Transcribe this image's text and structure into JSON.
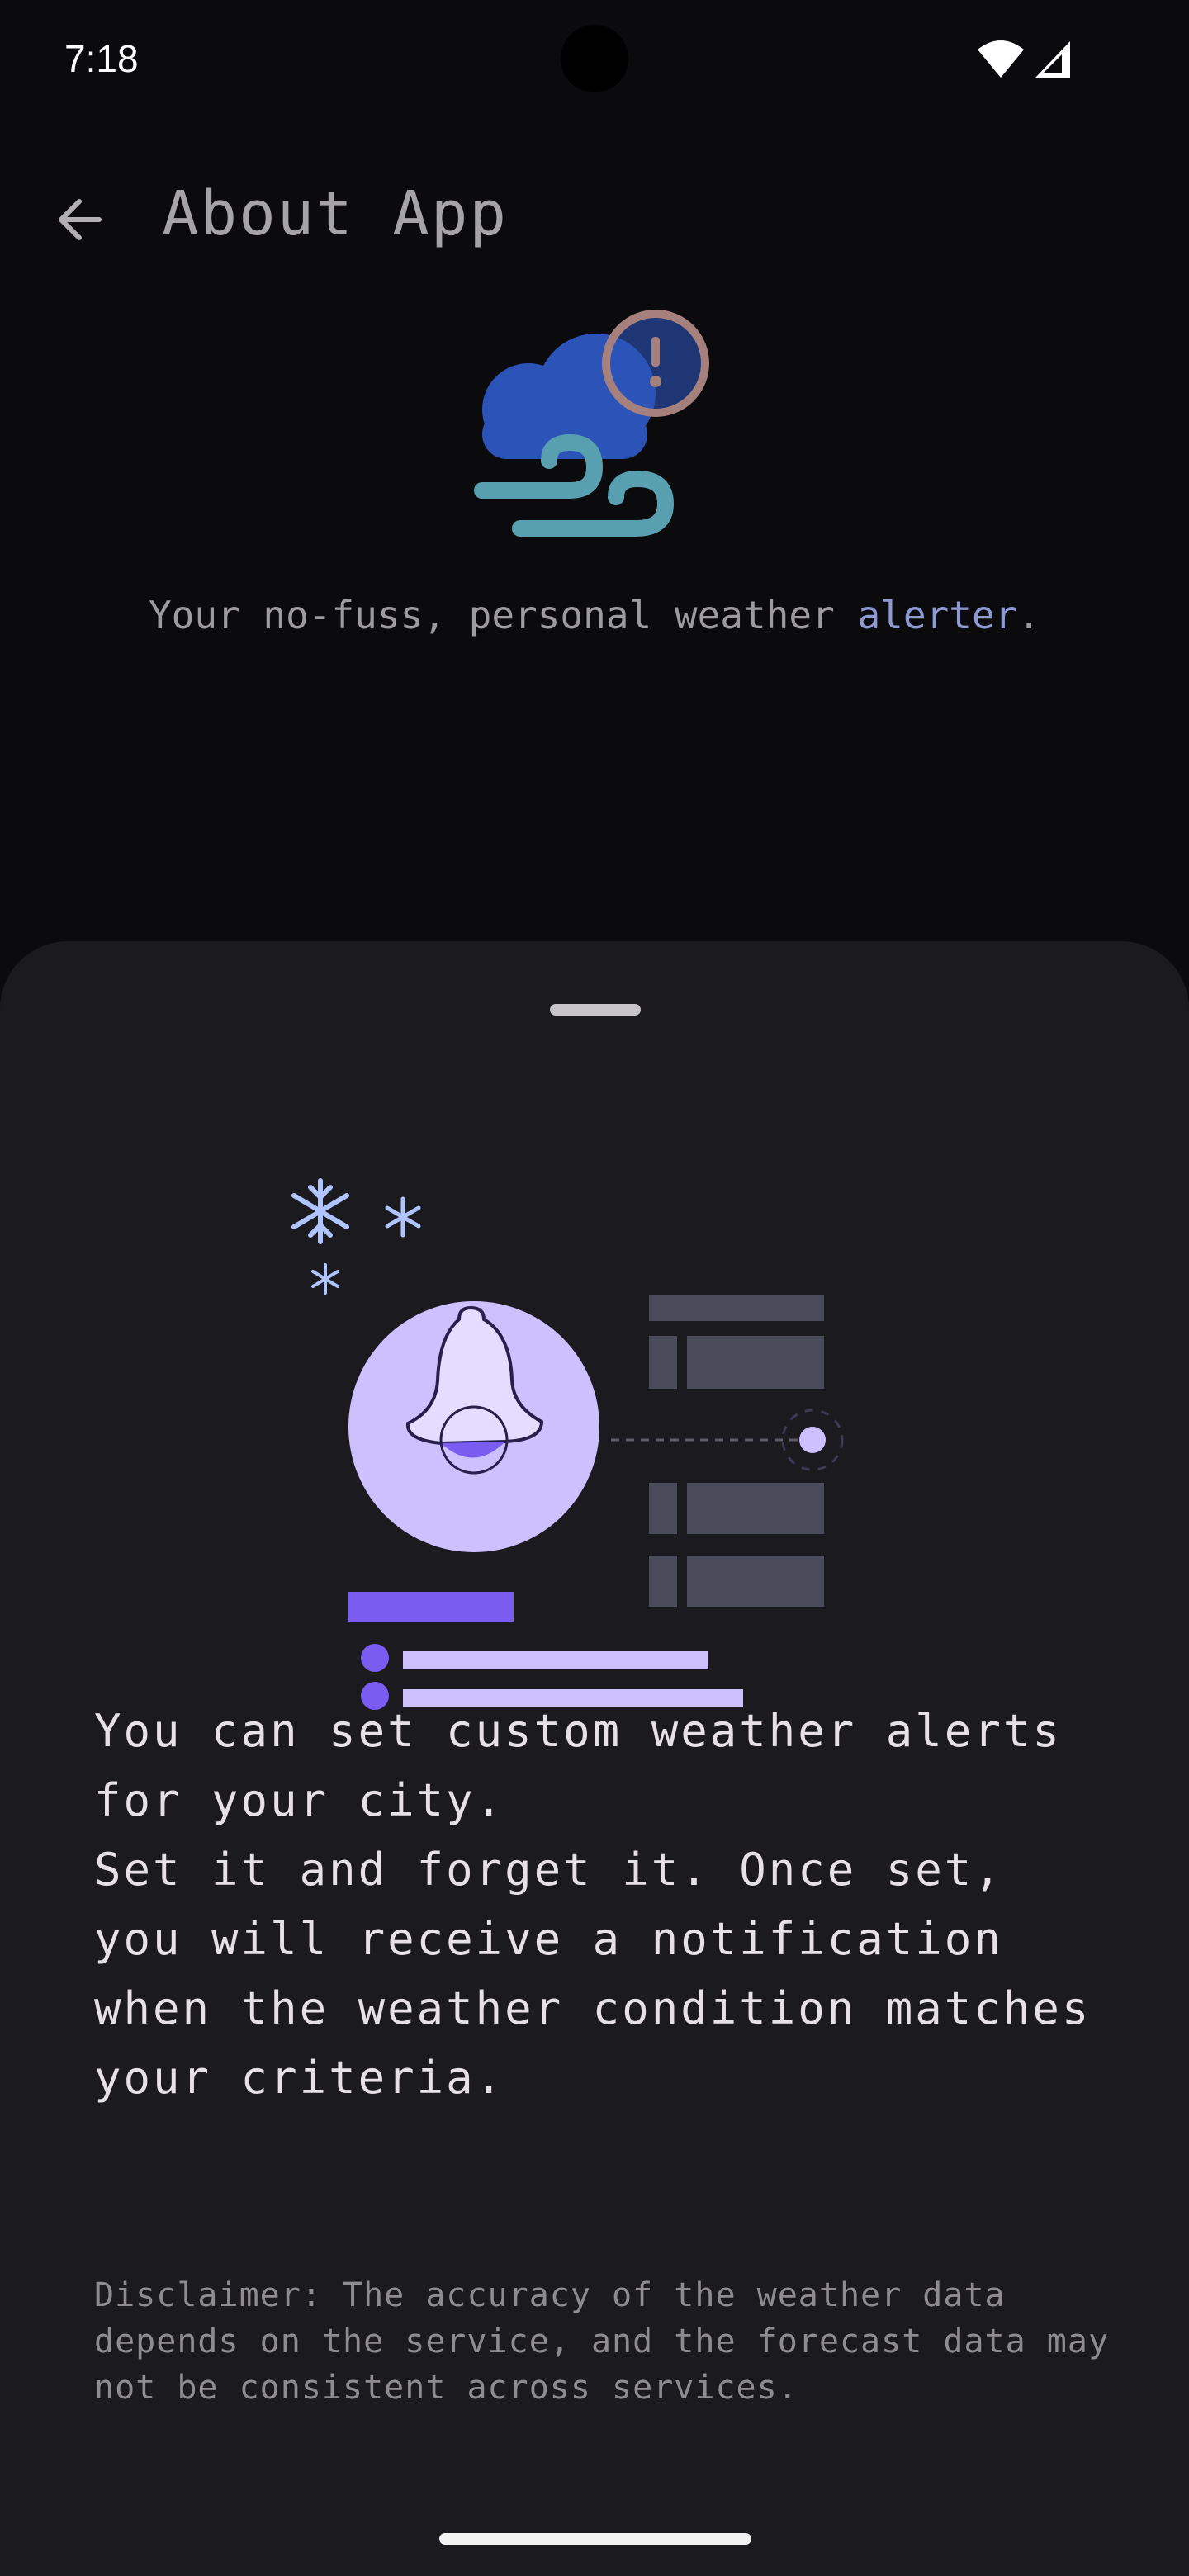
{
  "status_bar": {
    "time": "7:18",
    "icons": [
      "wifi-icon",
      "cellular-signal-icon"
    ]
  },
  "app_bar": {
    "title": "About App",
    "back_icon": "arrow-back-icon"
  },
  "header": {
    "logo_icon": "weather-alert-logo-icon",
    "tagline_prefix": "Your no-fuss, personal weather ",
    "tagline_accent": "alerter",
    "tagline_suffix": "."
  },
  "sheet": {
    "illustration_icon": "weather-alert-notification-illustration",
    "paragraph_1": "You can set custom weather alerts for your city.",
    "paragraph_2": "Set it and forget it. Once set, you will receive a notification when the weather condition matches your criteria.",
    "disclaimer": "Disclaimer: The accuracy of the weather data depends on the service, and the forecast data may not be consistent across services."
  },
  "colors": {
    "background": "#0b0b0d",
    "sheet": "#1b1b1f",
    "accent_text": "#8e9ad4",
    "illustration_purple": "#7b5cf0",
    "illustration_lavender": "#cdc0ff"
  }
}
